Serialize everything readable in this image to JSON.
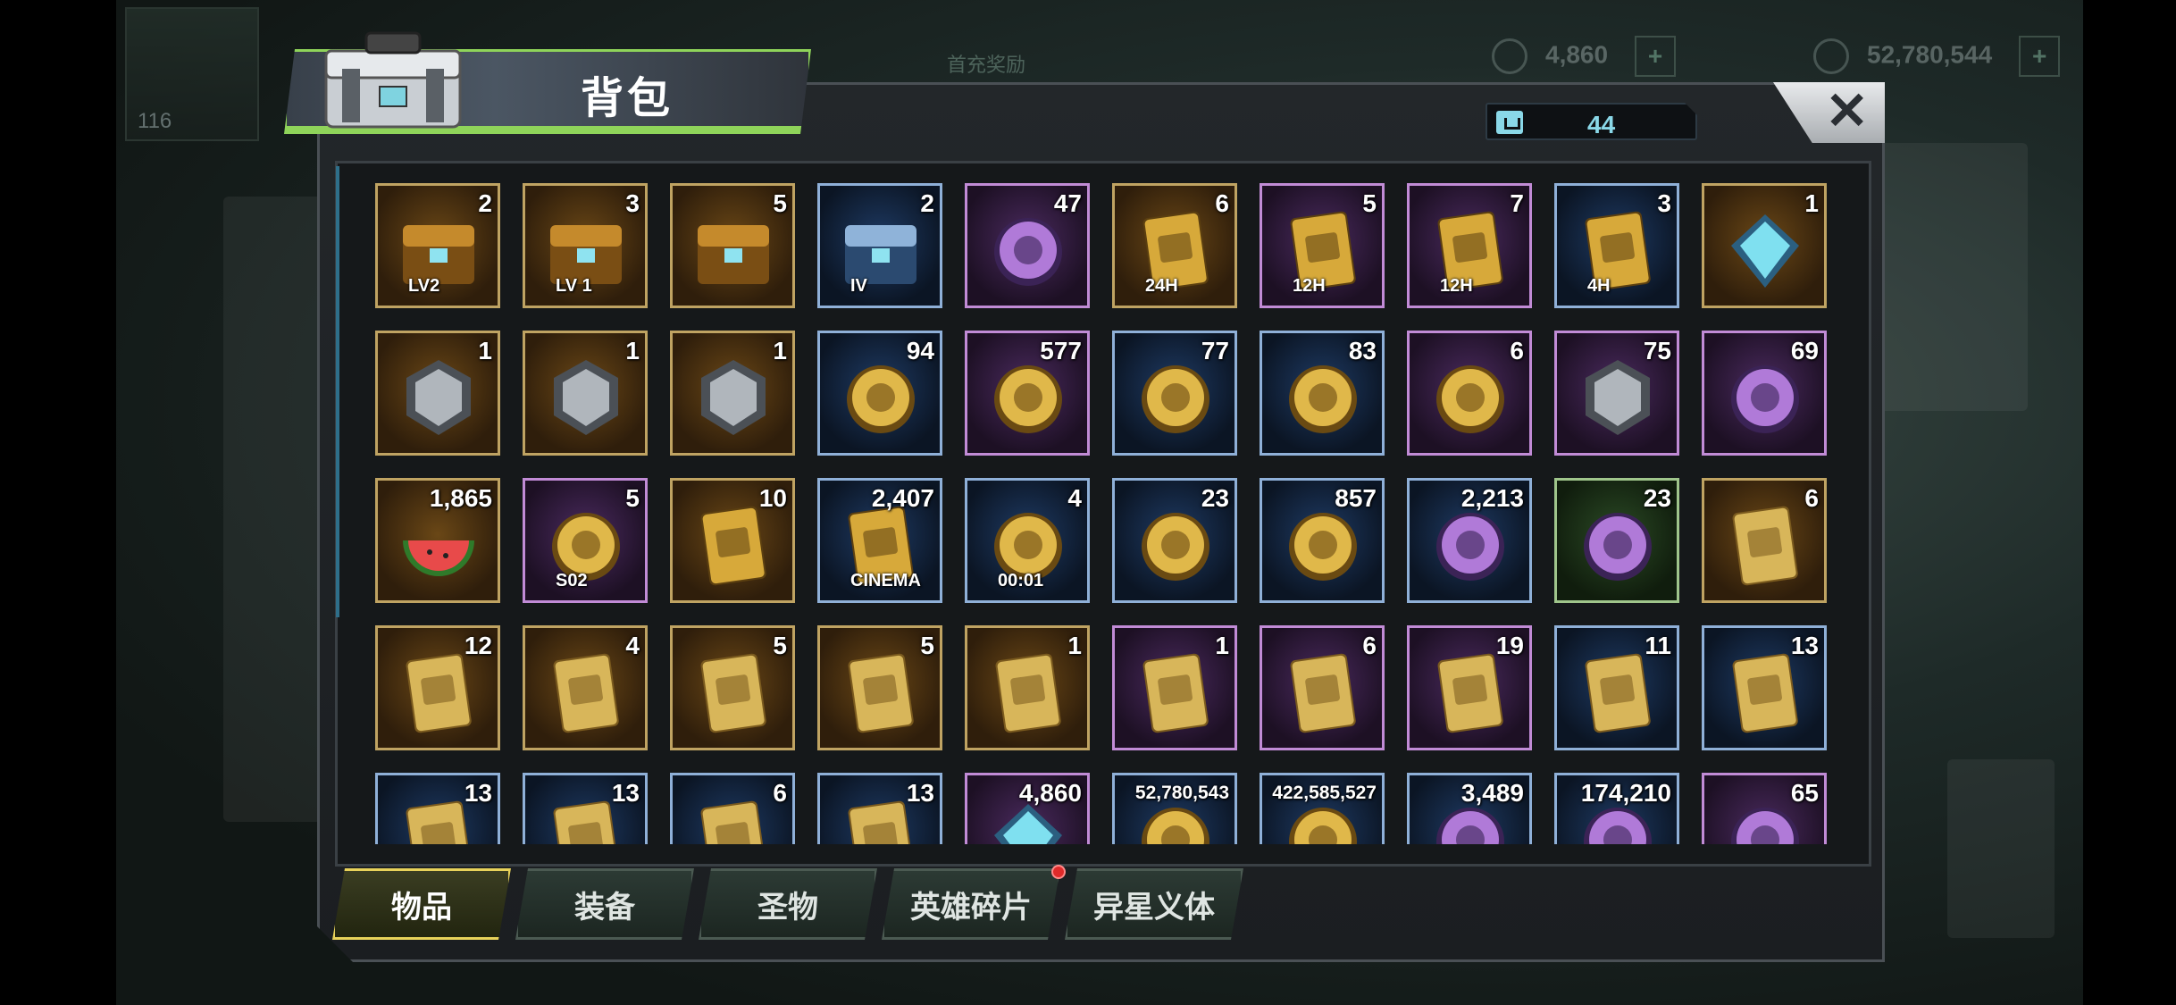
{
  "header": {
    "title": "背包"
  },
  "capacity": {
    "value": "44",
    "icon": "bag-icon"
  },
  "close": {
    "label": "✕"
  },
  "background": {
    "res1": "4,860",
    "res2": "52,780,544",
    "hud_level": "116",
    "banner": "首充奖励"
  },
  "items": [
    {
      "count": "2",
      "frame": "gold",
      "icon": "lv2-treasure-chest-icon",
      "tag": "LV2",
      "art": "chest"
    },
    {
      "count": "3",
      "frame": "gold",
      "icon": "lv1-treasure-chest-icon",
      "tag": "LV 1",
      "art": "chest"
    },
    {
      "count": "5",
      "frame": "gold",
      "icon": "bronze-chest-icon",
      "art": "chest"
    },
    {
      "count": "2",
      "frame": "blue",
      "icon": "tier-iv-crate-icon",
      "tag": "IV",
      "art": "crate"
    },
    {
      "count": "47",
      "frame": "purple",
      "icon": "robot-part-icon",
      "art": "orb"
    },
    {
      "count": "6",
      "frame": "gold",
      "icon": "gold-24h-speedup-icon",
      "tag": "24H",
      "art": "card"
    },
    {
      "count": "5",
      "frame": "purple",
      "icon": "research-12h-speedup-icon",
      "tag": "12H",
      "art": "card"
    },
    {
      "count": "7",
      "frame": "purple",
      "icon": "gold-12h-speedup-icon",
      "tag": "12H",
      "art": "card"
    },
    {
      "count": "3",
      "frame": "blue",
      "icon": "gold-4h-speedup-icon",
      "tag": "4H",
      "art": "card"
    },
    {
      "count": "1",
      "frame": "gold",
      "icon": "diamond-triangle-icon",
      "art": "gem"
    },
    {
      "count": "1",
      "frame": "gold",
      "icon": "purple-skill-badge-icon",
      "art": "badge"
    },
    {
      "count": "1",
      "frame": "gold",
      "icon": "green-skill-badge-icon",
      "art": "badge"
    },
    {
      "count": "1",
      "frame": "gold",
      "icon": "silver-skill-badge-icon",
      "art": "badge"
    },
    {
      "count": "94",
      "frame": "blue",
      "icon": "lips-cap-icon",
      "art": "coin"
    },
    {
      "count": "577",
      "frame": "purple",
      "icon": "wheat-coin-icon",
      "art": "coin"
    },
    {
      "count": "77",
      "frame": "blue",
      "icon": "film-reel-icon",
      "art": "coin"
    },
    {
      "count": "83",
      "frame": "blue",
      "icon": "purple-s-cap-icon",
      "art": "coin"
    },
    {
      "count": "6",
      "frame": "purple",
      "icon": "spade-chip-icon",
      "art": "coin"
    },
    {
      "count": "75",
      "frame": "purple",
      "icon": "police-badge-icon",
      "art": "badge"
    },
    {
      "count": "69",
      "frame": "purple",
      "icon": "shark-trophy-icon",
      "art": "orb"
    },
    {
      "count": "1,865",
      "frame": "gold",
      "icon": "watermelon-icon",
      "art": "fruit"
    },
    {
      "count": "5",
      "frame": "purple",
      "icon": "season-s02-coin-icon",
      "tag": "S02",
      "art": "coin"
    },
    {
      "count": "10",
      "frame": "gold",
      "icon": "ticket-bundle-icon",
      "art": "card"
    },
    {
      "count": "2,407",
      "frame": "blue",
      "icon": "cinema-ticket-icon",
      "tag": "CINEMA",
      "art": "card"
    },
    {
      "count": "4",
      "frame": "blue",
      "icon": "timer-coin-icon",
      "tag": "00:01",
      "art": "coin"
    },
    {
      "count": "23",
      "frame": "blue",
      "icon": "blue-b-cap-icon",
      "art": "coin"
    },
    {
      "count": "857",
      "frame": "blue",
      "icon": "poker-chip-icon",
      "art": "coin"
    },
    {
      "count": "2,213",
      "frame": "blue",
      "icon": "bullet-icon",
      "art": "orb"
    },
    {
      "count": "23",
      "frame": "green",
      "icon": "frog-ring-icon",
      "art": "orb"
    },
    {
      "count": "6",
      "frame": "gold",
      "icon": "boots-blueprint-icon",
      "art": "blueprint"
    },
    {
      "count": "12",
      "frame": "gold",
      "icon": "shirt-blueprint-icon",
      "art": "blueprint"
    },
    {
      "count": "4",
      "frame": "gold",
      "icon": "glasses-blueprint-icon",
      "art": "blueprint"
    },
    {
      "count": "5",
      "frame": "gold",
      "icon": "hat-blueprint-icon",
      "art": "blueprint"
    },
    {
      "count": "5",
      "frame": "gold",
      "icon": "swords-blueprint-icon",
      "art": "blueprint"
    },
    {
      "count": "1",
      "frame": "gold",
      "icon": "pistol-blueprint-icon",
      "art": "blueprint"
    },
    {
      "count": "1",
      "frame": "purple",
      "icon": "hat-blueprint-purple-icon",
      "art": "blueprint"
    },
    {
      "count": "6",
      "frame": "purple",
      "icon": "boots-blueprint-purple-icon",
      "art": "blueprint"
    },
    {
      "count": "19",
      "frame": "purple",
      "icon": "shirt-blueprint-purple-icon",
      "art": "blueprint"
    },
    {
      "count": "11",
      "frame": "blue",
      "icon": "boots-blueprint-blue-icon",
      "art": "blueprint"
    },
    {
      "count": "13",
      "frame": "blue",
      "icon": "swords-blueprint-blue-icon",
      "art": "blueprint"
    },
    {
      "count": "13",
      "frame": "blue",
      "icon": "glove-blueprint-blue-icon",
      "art": "blueprint"
    },
    {
      "count": "13",
      "frame": "blue",
      "icon": "shirt-blueprint-blue-icon",
      "art": "blueprint"
    },
    {
      "count": "6",
      "frame": "blue",
      "icon": "glasses-blueprint-blue-icon",
      "art": "blueprint"
    },
    {
      "count": "13",
      "frame": "blue",
      "icon": "shirt-blueprint-blue-2-icon",
      "art": "blueprint"
    },
    {
      "count": "4,860",
      "frame": "purple",
      "icon": "purple-gem-icon",
      "art": "gem"
    },
    {
      "count": "52,780,543",
      "frame": "blue",
      "icon": "gold-coins-icon",
      "small": true,
      "art": "coin"
    },
    {
      "count": "422,585,527",
      "frame": "blue",
      "icon": "green-cash-icon",
      "small": true,
      "art": "coin"
    },
    {
      "count": "3,489",
      "frame": "blue",
      "icon": "purple-orb-icon",
      "art": "orb"
    },
    {
      "count": "174,210",
      "frame": "blue",
      "icon": "gear-icon",
      "art": "orb"
    },
    {
      "count": "65",
      "frame": "purple",
      "icon": "red-node-icon",
      "art": "orb"
    }
  ],
  "tabs": [
    {
      "label": "物品",
      "active": true
    },
    {
      "label": "装备",
      "active": false
    },
    {
      "label": "圣物",
      "active": false
    },
    {
      "label": "英雄碎片",
      "active": false,
      "dot": true
    },
    {
      "label": "异星义体",
      "active": false
    }
  ],
  "colors": {
    "accent_green": "#8fd45a",
    "capacity_cyan": "#8ad8e8",
    "active_tab": "#e8d25a",
    "alert_red": "#e02a2a"
  }
}
